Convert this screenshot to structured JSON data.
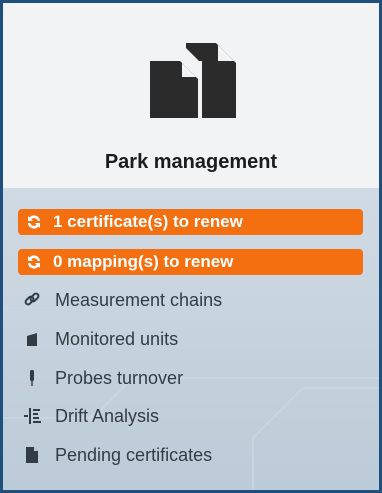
{
  "card": {
    "title": "Park management",
    "icon": "documents-icon"
  },
  "alerts": [
    {
      "label": "1 certificate(s) to renew",
      "icon": "refresh-icon",
      "color": "#f36f10"
    },
    {
      "label": "0 mapping(s) to renew",
      "icon": "refresh-icon",
      "color": "#f36f10"
    }
  ],
  "menu": [
    {
      "label": "Measurement chains",
      "icon": "link-icon"
    },
    {
      "label": "Monitored units",
      "icon": "unit-icon"
    },
    {
      "label": "Probes turnover",
      "icon": "probe-icon"
    },
    {
      "label": "Drift Analysis",
      "icon": "drift-icon"
    },
    {
      "label": "Pending certificates",
      "icon": "document-icon"
    }
  ]
}
